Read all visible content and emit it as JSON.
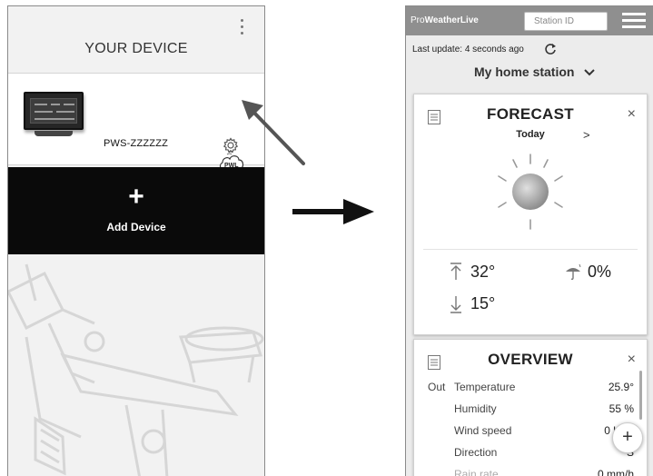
{
  "left": {
    "title": "YOUR DEVICE",
    "device_name": "PWS-ZZZZZZ",
    "add_device_symbol": "+",
    "add_device_label": "Add Device",
    "icons": [
      "more-vert-icon",
      "pwl-cloud-icon",
      "gear-icon",
      "weather-station-illustration"
    ]
  },
  "right": {
    "brand_prefix": "Pro",
    "brand_name": "WeatherLive",
    "station_id_placeholder": "Station ID",
    "last_update": "Last update: 4 seconds ago",
    "station_name": "My home station",
    "forecast": {
      "title": "FORECAST",
      "day": "Today",
      "next": ">",
      "close": "×",
      "high": "32°",
      "low": "15°",
      "rain": "0%"
    },
    "overview": {
      "title": "OVERVIEW",
      "close": "×",
      "rows": [
        {
          "prefix": "Out",
          "label": "Temperature",
          "value": "25.9°"
        },
        {
          "prefix": "",
          "label": "Humidity",
          "value": "55 %"
        },
        {
          "prefix": "",
          "label": "Wind speed",
          "value": "0 knot"
        },
        {
          "prefix": "",
          "label": "Direction",
          "value": "S"
        },
        {
          "prefix": "",
          "label": "Rain rate",
          "value": "0 mm/h"
        }
      ]
    },
    "fab_label": "+"
  },
  "colors": {
    "topbar": "#8f8f8f",
    "add_device_bg": "#0a0a0a",
    "page_bg": "#ececec"
  }
}
